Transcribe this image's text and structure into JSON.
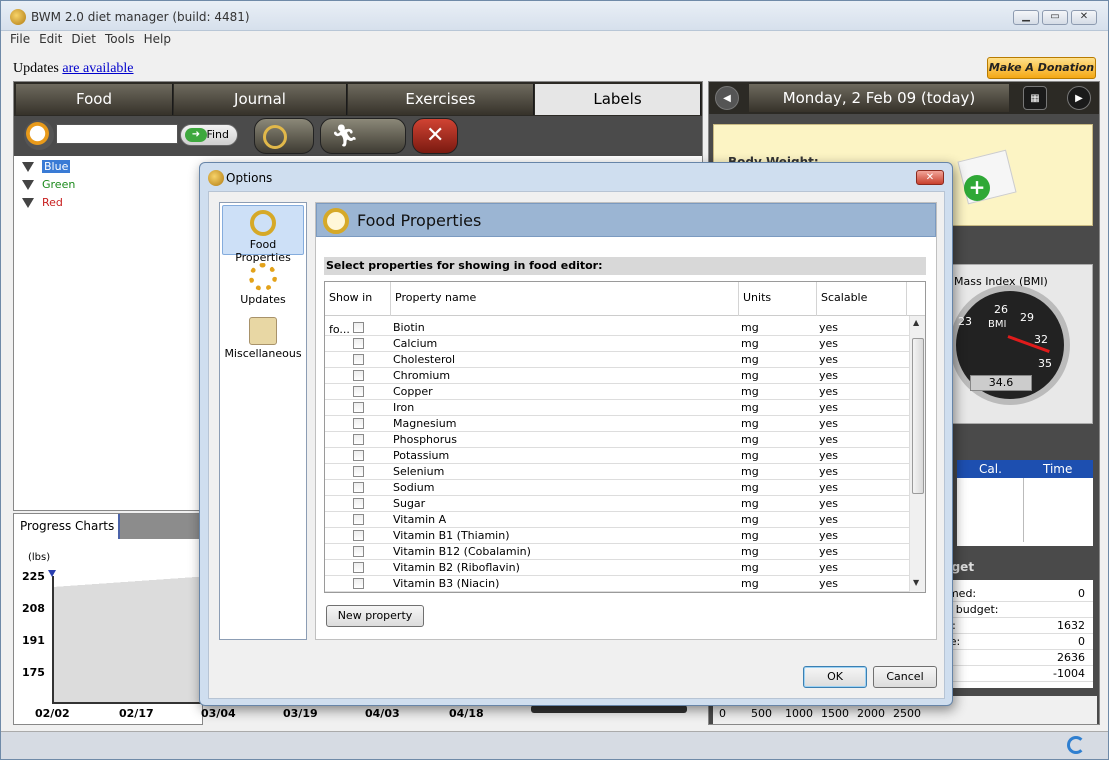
{
  "app": {
    "title": "BWM 2.0 diet manager (build: 4481)"
  },
  "window_controls": {
    "min": "▁",
    "max": "▭",
    "close": "✕"
  },
  "menu": [
    "File",
    "Edit",
    "Diet",
    "Tools",
    "Help"
  ],
  "updates": {
    "prefix": "Updates ",
    "link": "are available"
  },
  "donate": "Make A Donation",
  "tabs": [
    {
      "label": "Food",
      "active": false
    },
    {
      "label": "Journal",
      "active": false
    },
    {
      "label": "Exercises",
      "active": false
    },
    {
      "label": "Labels",
      "active": true
    }
  ],
  "toolbar": {
    "find_label": "Find",
    "search_placeholder": ""
  },
  "labels": [
    {
      "name": "Blue",
      "color": "#1c3fb8"
    },
    {
      "name": "Green",
      "color": "#1b8a1b"
    },
    {
      "name": "Red",
      "color": "#c81e1e"
    }
  ],
  "progress": {
    "tab": "Progress Charts",
    "unit": "(lbs)",
    "yticks": [
      "225",
      "208",
      "191",
      "175"
    ],
    "xticks": [
      "02/02",
      "02/17",
      "03/04",
      "03/19",
      "04/03",
      "04/18"
    ]
  },
  "date": {
    "label": "Monday, 2 Feb 09 (today)"
  },
  "body_weight_label": "Body Weight:",
  "bmi": {
    "title": "Mass Index (BMI)",
    "label": "BMI",
    "value": "34.6",
    "ticks": [
      "23",
      "26",
      "29",
      "32",
      "35"
    ]
  },
  "meals_table": {
    "headers": [
      "Cal.",
      "Time"
    ]
  },
  "budget": {
    "title": "dget",
    "rows": [
      {
        "label": "umed:",
        "value": "0"
      },
      {
        "label": "er budget:",
        "value": ""
      },
      {
        "label": "et:",
        "value": "1632"
      },
      {
        "label": "ise:",
        "value": "0"
      },
      {
        "label": "",
        "value": "2636"
      },
      {
        "label": "t:",
        "value": "-1004"
      }
    ]
  },
  "bottom_axis": [
    "0",
    "500",
    "1000",
    "1500",
    "2000",
    "2500"
  ],
  "dialog": {
    "title": "Options",
    "close": "✕",
    "sidebar": [
      {
        "label": "Food Properties",
        "selected": true
      },
      {
        "label": "Updates",
        "selected": false
      },
      {
        "label": "Miscellaneous",
        "selected": false
      }
    ],
    "header": "Food Properties",
    "instruction": "Select properties for showing in food editor:",
    "columns": [
      "Show in fo...",
      "Property name",
      "Units",
      "Scalable"
    ],
    "properties": [
      {
        "name": "Biotin",
        "units": "mg",
        "scalable": "yes"
      },
      {
        "name": "Calcium",
        "units": "mg",
        "scalable": "yes"
      },
      {
        "name": "Cholesterol",
        "units": "mg",
        "scalable": "yes"
      },
      {
        "name": "Chromium",
        "units": "mg",
        "scalable": "yes"
      },
      {
        "name": "Copper",
        "units": "mg",
        "scalable": "yes"
      },
      {
        "name": "Iron",
        "units": "mg",
        "scalable": "yes"
      },
      {
        "name": "Magnesium",
        "units": "mg",
        "scalable": "yes"
      },
      {
        "name": "Phosphorus",
        "units": "mg",
        "scalable": "yes"
      },
      {
        "name": "Potassium",
        "units": "mg",
        "scalable": "yes"
      },
      {
        "name": "Selenium",
        "units": "mg",
        "scalable": "yes"
      },
      {
        "name": "Sodium",
        "units": "mg",
        "scalable": "yes"
      },
      {
        "name": "Sugar",
        "units": "mg",
        "scalable": "yes"
      },
      {
        "name": "Vitamin A",
        "units": "mg",
        "scalable": "yes"
      },
      {
        "name": "Vitamin B1 (Thiamin)",
        "units": "mg",
        "scalable": "yes"
      },
      {
        "name": "Vitamin B12 (Cobalamin)",
        "units": "mg",
        "scalable": "yes"
      },
      {
        "name": "Vitamin B2 (Riboflavin)",
        "units": "mg",
        "scalable": "yes"
      },
      {
        "name": "Vitamin B3 (Niacin)",
        "units": "mg",
        "scalable": "yes"
      }
    ],
    "new_property": "New property",
    "ok": "OK",
    "cancel": "Cancel"
  }
}
